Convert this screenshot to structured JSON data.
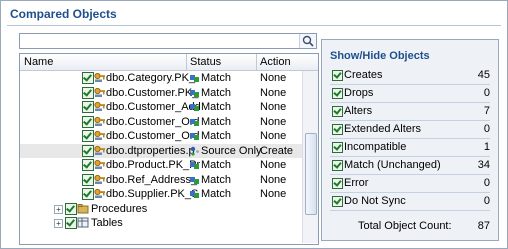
{
  "title": "Compared Objects",
  "search": {
    "placeholder": ""
  },
  "grid": {
    "headers": {
      "name": "Name",
      "status": "Status",
      "action": "Action"
    },
    "rows": [
      {
        "name": "dbo.Category.PK_",
        "status": "Match",
        "action": "None"
      },
      {
        "name": "dbo.Customer.PK_",
        "status": "Match",
        "action": "None"
      },
      {
        "name": "dbo.Customer_Add",
        "status": "Match",
        "action": "None"
      },
      {
        "name": "dbo.Customer_Ord",
        "status": "Match",
        "action": "None"
      },
      {
        "name": "dbo.Customer_Ord",
        "status": "Match",
        "action": "None"
      },
      {
        "name": "dbo.dtproperties.p",
        "status": "Source Only",
        "action": "Create",
        "selected": true
      },
      {
        "name": "dbo.Product.PK_Pr",
        "status": "Match",
        "action": "None"
      },
      {
        "name": "dbo.Ref_Address_",
        "status": "Match",
        "action": "None"
      },
      {
        "name": "dbo.Supplier.PK_S",
        "status": "Match",
        "action": "None"
      }
    ],
    "groups": [
      {
        "label": "Procedures"
      },
      {
        "label": "Tables"
      }
    ]
  },
  "panel": {
    "title": "Show/Hide Objects",
    "items": [
      {
        "label": "Creates",
        "count": "45"
      },
      {
        "label": "Drops",
        "count": "0"
      },
      {
        "label": "Alters",
        "count": "7"
      },
      {
        "label": "Extended Alters",
        "count": "0"
      },
      {
        "label": "Incompatible",
        "count": "1"
      },
      {
        "label": "Match (Unchanged)",
        "count": "34"
      },
      {
        "label": "Error",
        "count": "0"
      },
      {
        "label": "Do Not Sync",
        "count": "0"
      }
    ],
    "total_label": "Total Object Count:",
    "total_count": "87"
  },
  "colors": {
    "title": "#1f4f8c",
    "border": "#9aa8bd",
    "panel_bg": "#eef2f7",
    "check": "#1e7a2c"
  },
  "icons": [
    "search-icon",
    "checkbox-icon",
    "key-object-icon",
    "match-status-icon",
    "source-only-status-icon",
    "expand-icon",
    "folder-icon"
  ]
}
